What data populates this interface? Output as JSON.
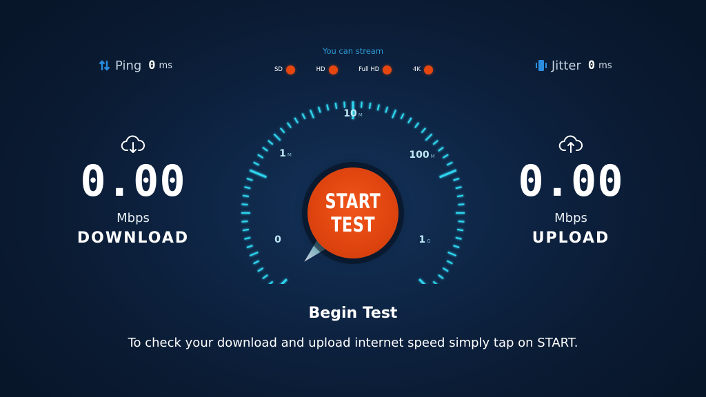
{
  "metrics": {
    "ping": {
      "label": "Ping",
      "value": "0",
      "unit": "ms",
      "icon": "up-down-arrows-icon"
    },
    "jitter": {
      "label": "Jitter",
      "value": "0",
      "unit": "ms",
      "icon": "jitter-icon"
    }
  },
  "stream": {
    "title": "You can stream",
    "items": [
      {
        "label": "SD",
        "status_color": "#e5470f"
      },
      {
        "label": "HD",
        "status_color": "#e5470f"
      },
      {
        "label": "Full HD",
        "status_color": "#e5470f"
      },
      {
        "label": "4K",
        "status_color": "#e5470f"
      }
    ]
  },
  "download": {
    "value": "0.00",
    "unit": "Mbps",
    "label": "DOWNLOAD",
    "icon": "cloud-download-icon"
  },
  "upload": {
    "value": "0.00",
    "unit": "Mbps",
    "label": "UPLOAD",
    "icon": "cloud-upload-icon"
  },
  "gauge": {
    "scale_labels": [
      {
        "num": "0",
        "unit": ""
      },
      {
        "num": "1",
        "unit": "M"
      },
      {
        "num": "10",
        "unit": "M"
      },
      {
        "num": "100",
        "unit": "M"
      },
      {
        "num": "1",
        "unit": "G"
      }
    ],
    "needle_value": 0,
    "accent_color": "#2fd6f0"
  },
  "start_button": {
    "line1": "START",
    "line2": "TEST"
  },
  "footer": {
    "title": "Begin Test",
    "description": "To check your download and upload internet speed simply tap on START."
  }
}
